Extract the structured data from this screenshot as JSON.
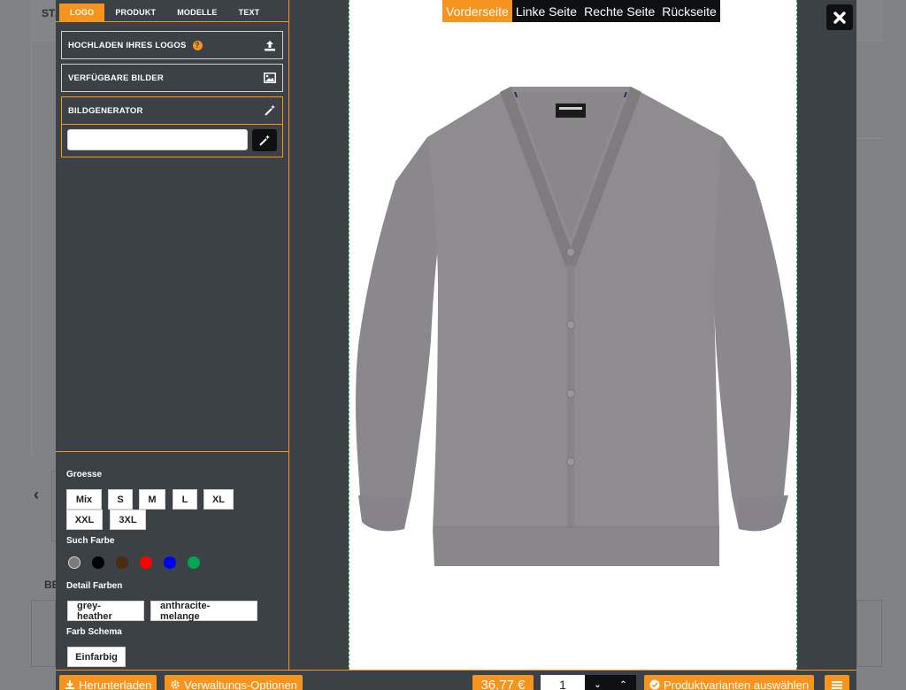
{
  "background": {
    "texts": {
      "st": "ST/",
      "be": "BE"
    }
  },
  "tabs": [
    {
      "label": "LOGO",
      "active": true
    },
    {
      "label": "PRODUKT",
      "active": false
    },
    {
      "label": "MODELLE",
      "active": false
    },
    {
      "label": "TEXT",
      "active": false
    }
  ],
  "accordion": {
    "upload_label": "HOCHLADEN IHRES LOGOS",
    "help_symbol": "?",
    "images_label": "VERFÜGBARE BILDER",
    "generator_label": "BILDGENERATOR",
    "generator_input_value": ""
  },
  "filters": {
    "size_label": "Groesse",
    "sizes": [
      "Mix",
      "S",
      "M",
      "L",
      "XL",
      "XXL",
      "3XL"
    ],
    "color_search_label": "Such Farbe",
    "color_swatches": [
      "#7b7b7b",
      "#000000",
      "#4a2c12",
      "#ff0000",
      "#0000ff",
      "#00a651"
    ],
    "detail_colors_label": "Detail Farben",
    "detail_colors": [
      "grey-heather",
      "anthracite-melange"
    ],
    "scheme_label": "Farb Schema",
    "schemes": [
      "Einfarbig"
    ]
  },
  "views": [
    {
      "label": "Vorderseite",
      "active": true
    },
    {
      "label": "Linke Seite",
      "active": false
    },
    {
      "label": "Rechte Seite",
      "active": false
    },
    {
      "label": "Rückseite",
      "active": false
    }
  ],
  "product": {
    "color": "#8f8c90",
    "collar_color": "#2b2f66"
  },
  "bottom": {
    "download_label": "Herunterladen",
    "admin_label": "Verwaltungs-Optionen",
    "price": "36,77 €",
    "quantity": "1",
    "variants_label": "Produktvarianten auswählen"
  },
  "colors": {
    "accent": "#f7941d",
    "panel": "#3c4145",
    "dark_button": "#0f1012"
  }
}
